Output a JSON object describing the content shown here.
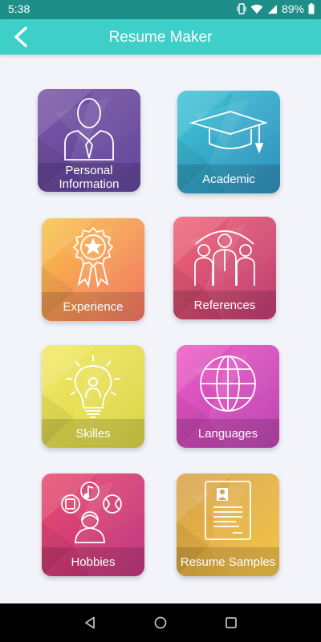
{
  "status": {
    "time": "5:38",
    "battery": "89%"
  },
  "header": {
    "title": "Resume Maker"
  },
  "tiles": [
    {
      "label": "Personal Information",
      "icon": "person-tie-icon",
      "colors": [
        "#7b5aa6",
        "#5a3a96"
      ]
    },
    {
      "label": "Academic",
      "icon": "graduation-cap-icon",
      "colors": [
        "#45c7d8",
        "#2287b8"
      ]
    },
    {
      "label": "Experience",
      "icon": "award-badge-icon",
      "colors": [
        "#f9c74a",
        "#f26c5a"
      ]
    },
    {
      "label": "References",
      "icon": "group-icon",
      "colors": [
        "#f26a7a",
        "#b83069"
      ]
    },
    {
      "label": "Skilles",
      "icon": "lightbulb-icon",
      "colors": [
        "#f2ea6a",
        "#d8d23a"
      ]
    },
    {
      "label": "Languages",
      "icon": "globe-icon",
      "colors": [
        "#ee5fc7",
        "#b83aae"
      ]
    },
    {
      "label": "Hobbies",
      "icon": "hobbies-icon",
      "colors": [
        "#ea4f6f",
        "#bb2b7a"
      ]
    },
    {
      "label": "Resume Samples",
      "icon": "document-icon",
      "colors": [
        "#d6a24d",
        "#f3c03b"
      ]
    }
  ]
}
